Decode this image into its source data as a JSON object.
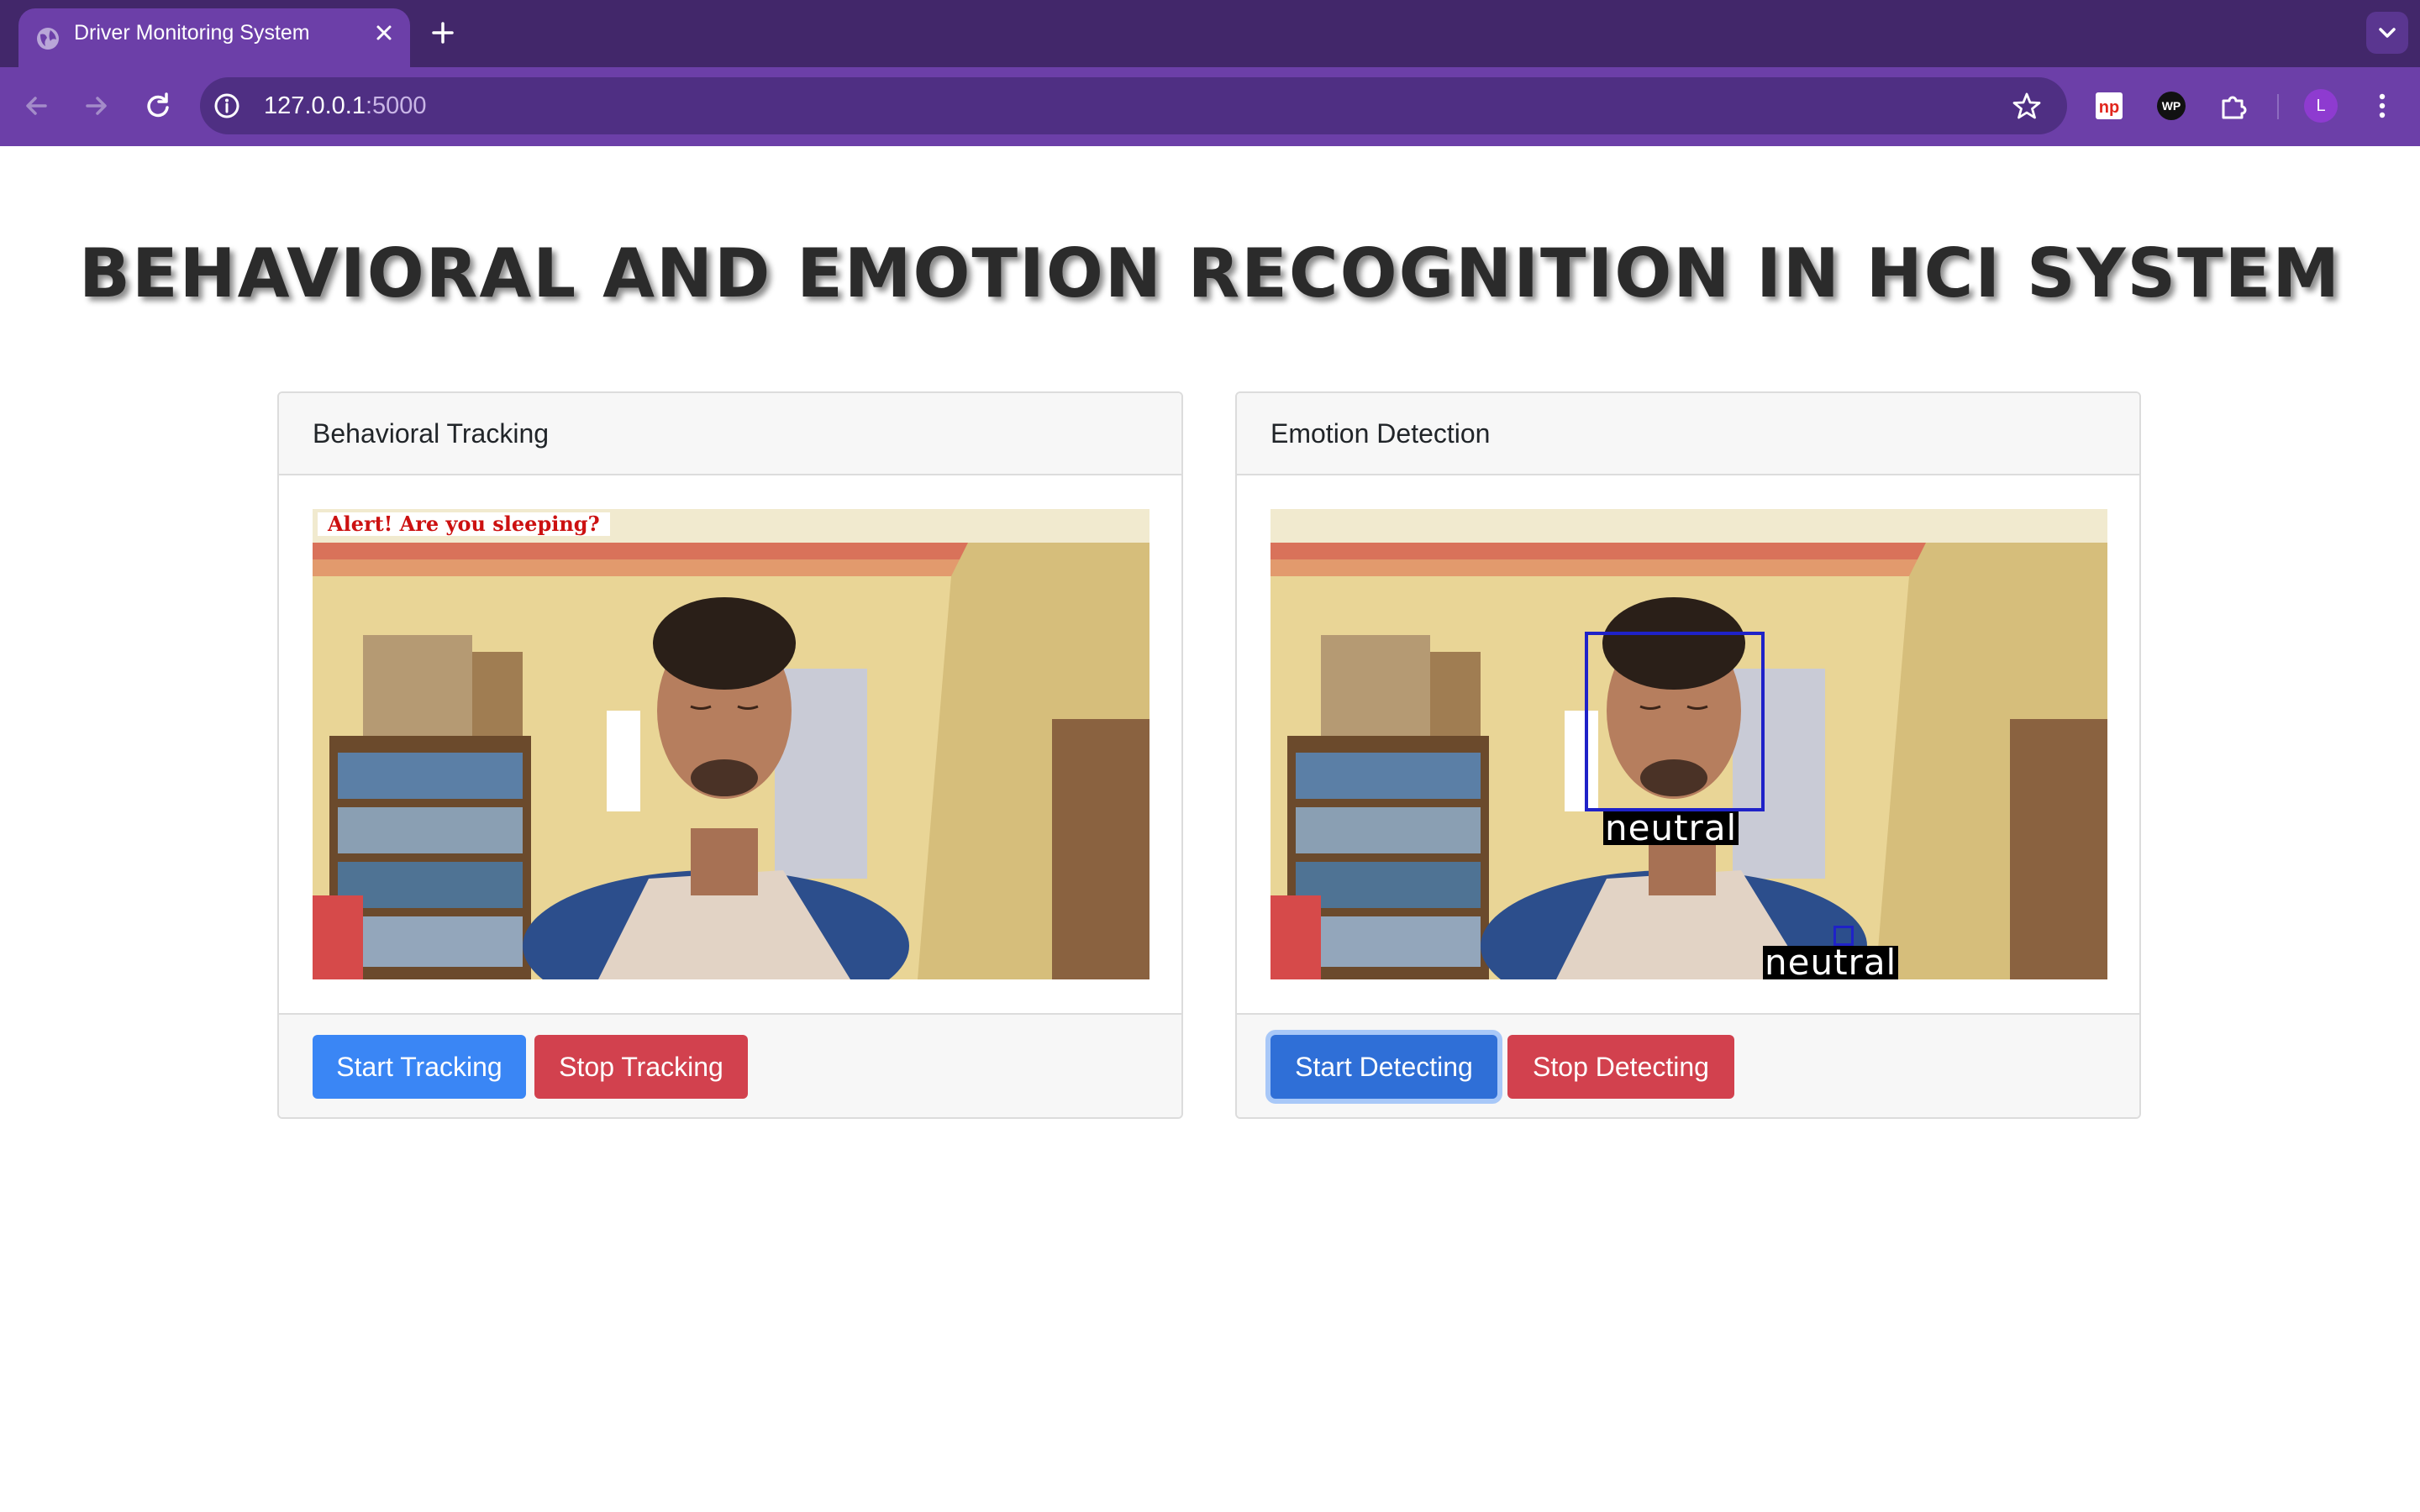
{
  "browser": {
    "tab_title": "Driver Monitoring System",
    "url_host": "127.0.0.1",
    "url_port": ":5000",
    "profile_initial": "L",
    "extensions": [
      "np-extension-icon",
      "wp-extension-icon",
      "puzzle-extension-icon"
    ]
  },
  "page": {
    "title": "BEHAVIORAL AND EMOTION RECOGNITION IN HCI SYSTEM"
  },
  "tracking_card": {
    "header": "Behavioral Tracking",
    "alert_text": "Alert! Are you sleeping?",
    "start_label": "Start Tracking",
    "stop_label": "Stop Tracking"
  },
  "emotion_card": {
    "header": "Emotion Detection",
    "detections": [
      {
        "label": "neutral"
      },
      {
        "label": "neutral"
      }
    ],
    "start_label": "Start Detecting",
    "stop_label": "Stop Detecting"
  },
  "colors": {
    "tab_bar": "#42276a",
    "toolbar": "#6c3fa8",
    "primary_button": "#3a86f5",
    "danger_button": "#d2414e",
    "face_box": "#1f22c8",
    "alert_text": "#cc1111"
  }
}
